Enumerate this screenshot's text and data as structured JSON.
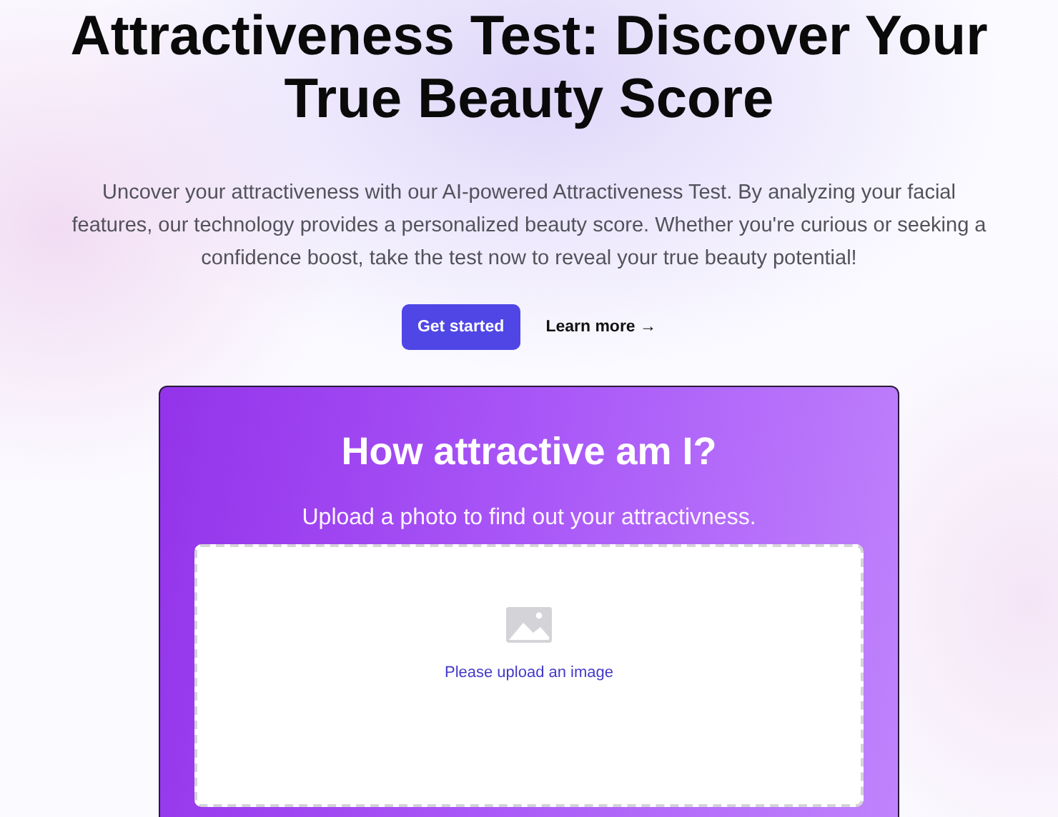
{
  "hero": {
    "title": "Attractiveness Test: Discover Your True Beauty Score",
    "description": "Uncover your attractiveness with our AI-powered Attractiveness Test. By analyzing your facial features, our technology provides a personalized beauty score. Whether you're curious or seeking a confidence boost, take the test now to reveal your true beauty potential!",
    "primary_button": "Get started",
    "secondary_link": "Learn more →"
  },
  "card": {
    "title": "How attractive am I?",
    "subtitle": "Upload a photo to find out your attractivness.",
    "dropzone": {
      "prompt": "Please upload an image"
    }
  }
}
